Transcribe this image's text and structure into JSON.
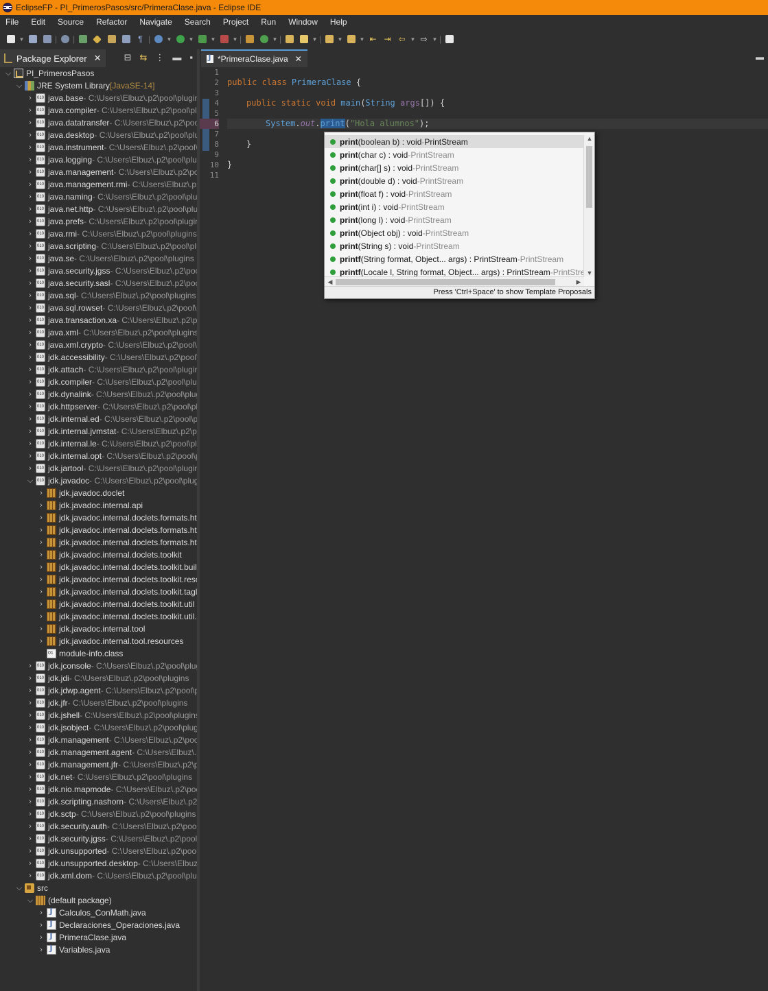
{
  "window": {
    "title": "EclipseFP - PI_PrimerosPasos/src/PrimeraClase.java - Eclipse IDE"
  },
  "menu": [
    "File",
    "Edit",
    "Source",
    "Refactor",
    "Navigate",
    "Search",
    "Project",
    "Run",
    "Window",
    "Help"
  ],
  "package_explorer": {
    "title": "Package Explorer",
    "project": "PI_PrimerosPasos",
    "jre": {
      "label": "JRE System Library",
      "decoration": "[JavaSE-14]"
    },
    "path_prefix": " - C:\\Users\\Elbuz\\.p2\\pool\\plugins",
    "modules": [
      "java.base",
      "java.compiler",
      "java.datatransfer",
      "java.desktop",
      "java.instrument",
      "java.logging",
      "java.management",
      "java.management.rmi",
      "java.naming",
      "java.net.http",
      "java.prefs",
      "java.rmi",
      "java.scripting",
      "java.se",
      "java.security.jgss",
      "java.security.sasl",
      "java.sql",
      "java.sql.rowset",
      "java.transaction.xa",
      "java.xml",
      "java.xml.crypto",
      "jdk.accessibility",
      "jdk.attach",
      "jdk.compiler",
      "jdk.dynalink",
      "jdk.httpserver",
      "jdk.internal.ed",
      "jdk.internal.jvmstat",
      "jdk.internal.le",
      "jdk.internal.opt",
      "jdk.jartool"
    ],
    "expanded_module": "jdk.javadoc",
    "expanded_children": [
      "jdk.javadoc.doclet",
      "jdk.javadoc.internal.api",
      "jdk.javadoc.internal.doclets.formats.html",
      "jdk.javadoc.internal.doclets.formats.html.markup",
      "jdk.javadoc.internal.doclets.formats.html.resources",
      "jdk.javadoc.internal.doclets.toolkit",
      "jdk.javadoc.internal.doclets.toolkit.builders",
      "jdk.javadoc.internal.doclets.toolkit.resources",
      "jdk.javadoc.internal.doclets.toolkit.taglets",
      "jdk.javadoc.internal.doclets.toolkit.util",
      "jdk.javadoc.internal.doclets.toolkit.util.links",
      "jdk.javadoc.internal.tool",
      "jdk.javadoc.internal.tool.resources"
    ],
    "module_info": "module-info.class",
    "modules_after": [
      "jdk.jconsole",
      "jdk.jdi",
      "jdk.jdwp.agent",
      "jdk.jfr",
      "jdk.jshell",
      "jdk.jsobject",
      "jdk.management",
      "jdk.management.agent",
      "jdk.management.jfr",
      "jdk.net",
      "jdk.nio.mapmode",
      "jdk.scripting.nashorn",
      "jdk.sctp",
      "jdk.security.auth",
      "jdk.security.jgss",
      "jdk.unsupported",
      "jdk.unsupported.desktop",
      "jdk.xml.dom"
    ],
    "src": "src",
    "default_package": "(default package)",
    "files": [
      "Calculos_ConMath.java",
      "Declaraciones_Operaciones.java",
      "PrimeraClase.java",
      "Variables.java"
    ]
  },
  "editor": {
    "tab": "*PrimeraClase.java",
    "line_numbers": [
      "1",
      "2",
      "3",
      "4",
      "5",
      "6",
      "7",
      "8",
      "9",
      "10",
      "11"
    ],
    "code": {
      "l2_kw": "public class ",
      "l2_name": "PrimeraClase",
      "l2_rest": " {",
      "l4_kw": "public static void ",
      "l4_name": "main",
      "l4_p1": "(",
      "l4_type": "String",
      "l4_sp": " ",
      "l4_arg": "args",
      "l4_rest": "[]) {",
      "l6_sys": "System",
      "l6_dot1": ".",
      "l6_out": "out",
      "l6_dot2": ".",
      "l6_print": "print",
      "l6_p": "(",
      "l6_str": "\"Hola alumnos\"",
      "l6_end": ");",
      "l8": "}",
      "l10": "}"
    }
  },
  "content_assist": {
    "proposals": [
      {
        "method": "print",
        "sig": "(boolean b) : void",
        "sep": " - ",
        "owner": "PrintStream"
      },
      {
        "method": "print",
        "sig": "(char c) : void",
        "sep": " - ",
        "owner": "PrintStream"
      },
      {
        "method": "print",
        "sig": "(char[] s) : void",
        "sep": " - ",
        "owner": "PrintStream"
      },
      {
        "method": "print",
        "sig": "(double d) : void",
        "sep": " - ",
        "owner": "PrintStream"
      },
      {
        "method": "print",
        "sig": "(float f) : void",
        "sep": " - ",
        "owner": "PrintStream"
      },
      {
        "method": "print",
        "sig": "(int i) : void",
        "sep": " - ",
        "owner": "PrintStream"
      },
      {
        "method": "print",
        "sig": "(long l) : void",
        "sep": " - ",
        "owner": "PrintStream"
      },
      {
        "method": "print",
        "sig": "(Object obj) : void",
        "sep": " - ",
        "owner": "PrintStream"
      },
      {
        "method": "print",
        "sig": "(String s) : void",
        "sep": " - ",
        "owner": "PrintStream"
      },
      {
        "method": "printf",
        "sig": "(String format, Object... args) : PrintStream",
        "sep": " - ",
        "owner": "PrintStream"
      },
      {
        "method": "printf",
        "sig": "(Locale l, String format, Object... args) : PrintStream",
        "sep": " - ",
        "owner": "PrintStream"
      }
    ],
    "footer": "Press 'Ctrl+Space' to show Template Proposals"
  }
}
